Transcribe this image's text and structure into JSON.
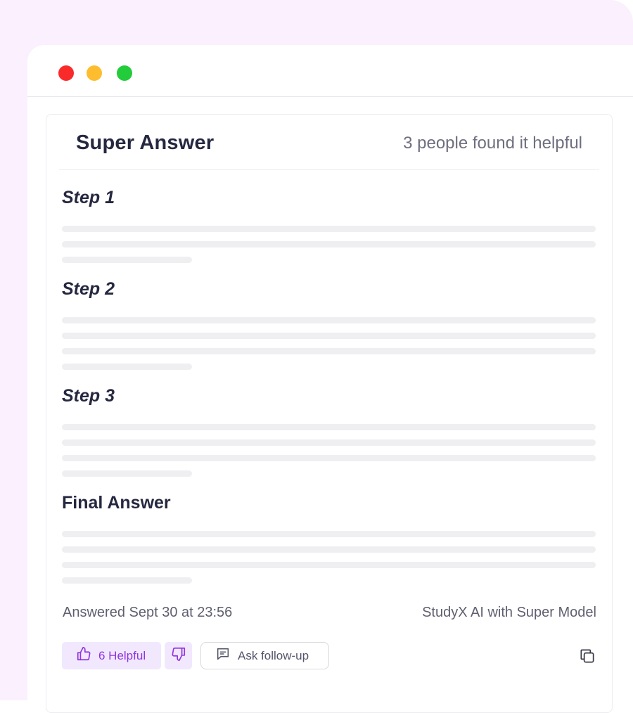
{
  "window": {
    "controls": [
      "close",
      "minimize",
      "maximize"
    ]
  },
  "answer": {
    "title": "Super Answer",
    "helpful_count_text": "3 people found it helpful",
    "steps": [
      {
        "title": "Step 1"
      },
      {
        "title": "Step 2"
      },
      {
        "title": "Step 3"
      }
    ],
    "final_title": "Final Answer",
    "answered_text": "Answered Sept 30 at 23:56",
    "source_text": "StudyX AI with Super Model"
  },
  "actions": {
    "helpful_label": "6 Helpful",
    "follow_up_label": "Ask follow-up",
    "icons": [
      "thumbs-up-icon",
      "thumbs-down-icon",
      "chat-icon",
      "copy-icon"
    ]
  },
  "colors": {
    "accent": "#9035e0",
    "accent_bg": "#f1e8fd",
    "close": "#fa2a2a",
    "minimize": "#fdbd2e",
    "maximize": "#22cc3a",
    "page_bg": "#fbf0fd"
  }
}
